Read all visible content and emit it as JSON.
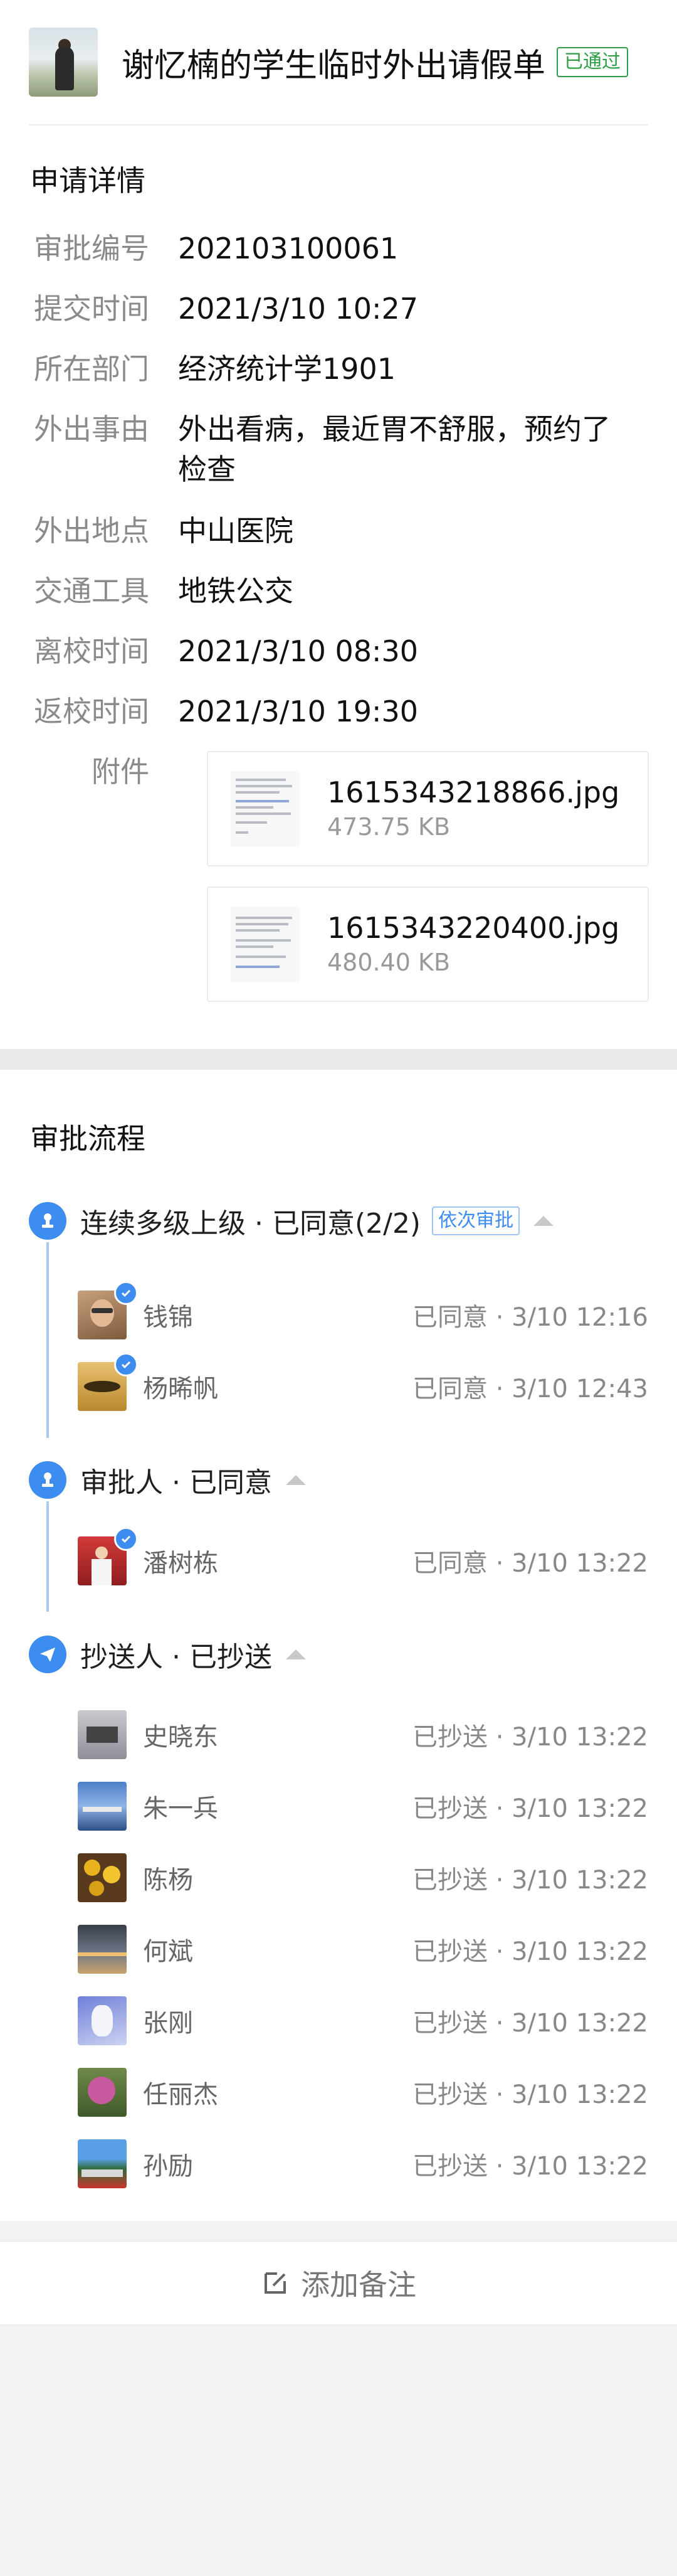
{
  "header": {
    "title": "谢忆楠的学生临时外出请假单",
    "status_badge": "已通过"
  },
  "details": {
    "section_title": "申请详情",
    "rows": [
      {
        "label": "审批编号",
        "value": "202103100061"
      },
      {
        "label": "提交时间",
        "value": "2021/3/10 10:27"
      },
      {
        "label": "所在部门",
        "value": "经济统计学1901"
      },
      {
        "label": "外出事由",
        "value": "外出看病，最近胃不舒服，预约了检查"
      },
      {
        "label": "外出地点",
        "value": "中山医院"
      },
      {
        "label": "交通工具",
        "value": "地铁公交"
      },
      {
        "label": "离校时间",
        "value": "2021/3/10 08:30"
      },
      {
        "label": "返校时间",
        "value": "2021/3/10 19:30"
      }
    ],
    "attachments_label": "附件",
    "attachments": [
      {
        "name": "1615343218866.jpg",
        "size": "473.75 KB"
      },
      {
        "name": "1615343220400.jpg",
        "size": "480.40 KB"
      }
    ]
  },
  "flow": {
    "section_title": "审批流程",
    "nodes": [
      {
        "title": "连续多级上级 · 已同意(2/2)",
        "tag": "依次审批",
        "icon": "approver-icon",
        "people": [
          {
            "name": "钱锦",
            "status": "已同意 · 3/10 12:16"
          },
          {
            "name": "杨晞帆",
            "status": "已同意 · 3/10 12:43"
          }
        ]
      },
      {
        "title": "审批人 · 已同意",
        "icon": "approver-icon",
        "people": [
          {
            "name": "潘树栋",
            "status": "已同意 · 3/10 13:22"
          }
        ]
      },
      {
        "title": "抄送人 · 已抄送",
        "icon": "send-icon",
        "people": [
          {
            "name": "史晓东",
            "status": "已抄送 · 3/10 13:22"
          },
          {
            "name": "朱一兵",
            "status": "已抄送 · 3/10 13:22"
          },
          {
            "name": "陈杨",
            "status": "已抄送 · 3/10 13:22"
          },
          {
            "name": "何斌",
            "status": "已抄送 · 3/10 13:22"
          },
          {
            "name": "张刚",
            "status": "已抄送 · 3/10 13:22"
          },
          {
            "name": "任丽杰",
            "status": "已抄送 · 3/10 13:22"
          },
          {
            "name": "孙励",
            "status": "已抄送 · 3/10 13:22"
          }
        ]
      }
    ]
  },
  "footer": {
    "add_note_label": "添加备注"
  },
  "colors": {
    "accent": "#3d8cf0",
    "pass_green": "#2f9e44",
    "label_gray": "#8a8a8a",
    "background": "#f2f2f2"
  }
}
